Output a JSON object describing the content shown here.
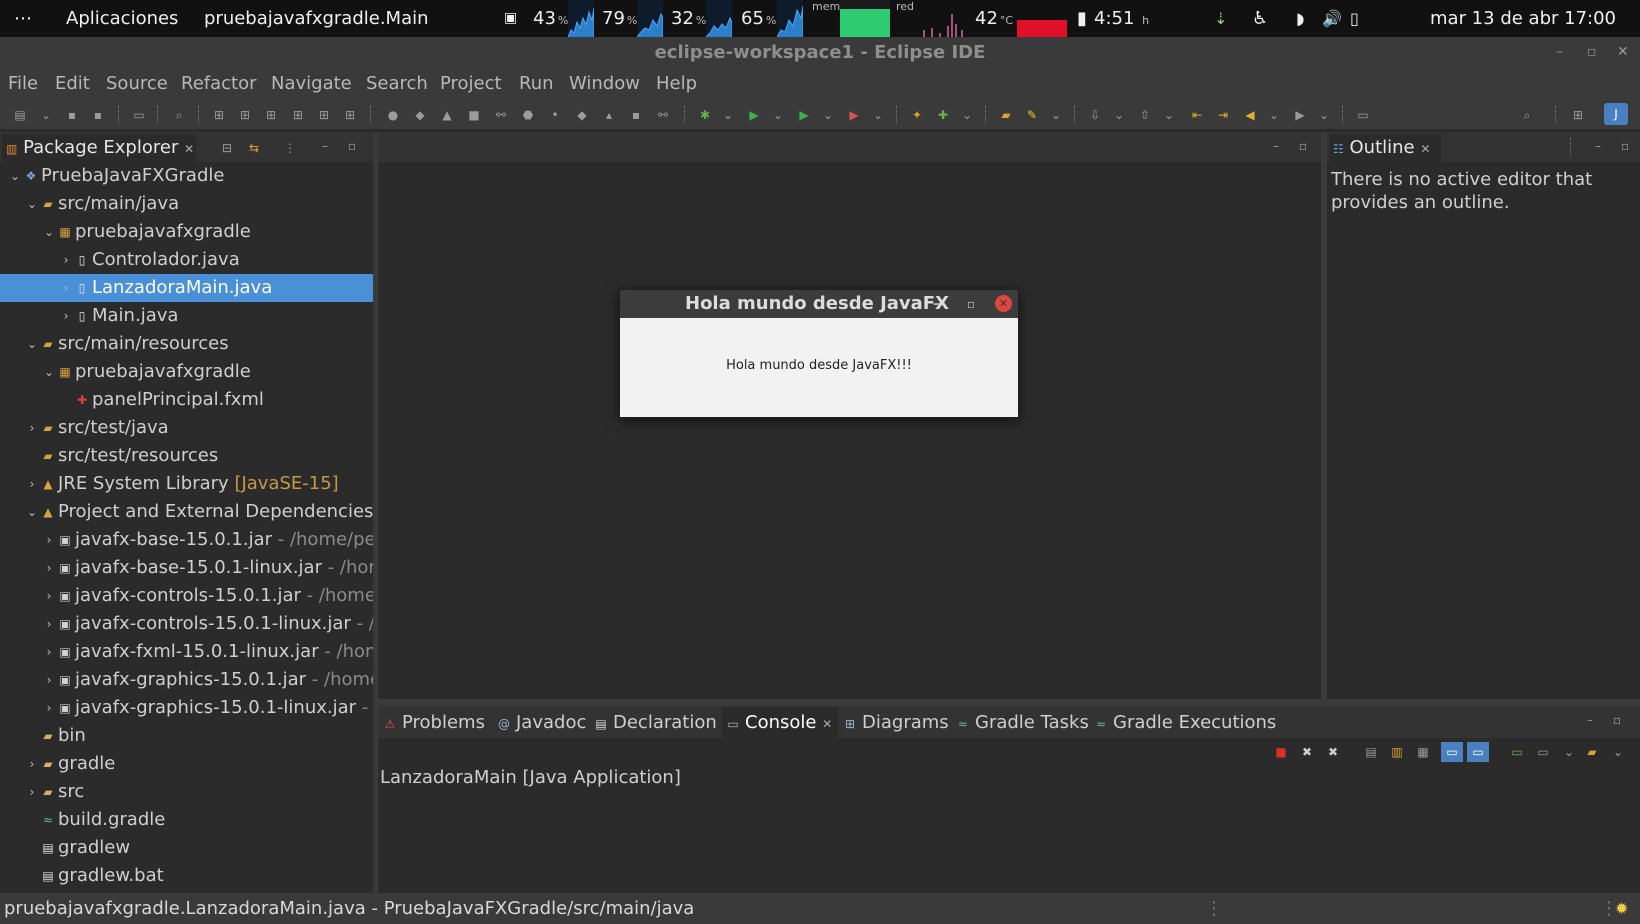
{
  "topbar": {
    "dots": "⋯",
    "apps": "Aplicaciones",
    "app_title": "pruebajavafxgradle.Main",
    "cpu": "43",
    "cpu_unit": "%",
    "mem_pct": "79",
    "mem_unit": "%",
    "swap_pct": "32",
    "swap_unit": "%",
    "load_pct": "65",
    "load_unit": "%",
    "mem_label": "mem",
    "net_label": "red",
    "temp": "42",
    "temp_unit": "°C",
    "battery_time": "4:51",
    "battery_unit": "h",
    "datetime": "mar 13 de abr  17:00"
  },
  "window": {
    "title": "eclipse-workspace1 - Eclipse IDE",
    "minimize": "–",
    "restore": "▫",
    "close": "✕"
  },
  "menu": [
    "File",
    "Edit",
    "Source",
    "Refactor",
    "Navigate",
    "Search",
    "Project",
    "Run",
    "Window",
    "Help"
  ],
  "package_explorer": {
    "title": "Package Explorer",
    "tree": [
      {
        "level": 0,
        "twisty": "v",
        "icon": "project-icon",
        "label": "PruebaJavaFXGradle",
        "dec": ""
      },
      {
        "level": 1,
        "twisty": "v",
        "icon": "source-folder-icon",
        "label": "src/main/java",
        "dec": ""
      },
      {
        "level": 2,
        "twisty": "v",
        "icon": "package-icon",
        "label": "pruebajavafxgradle",
        "dec": ""
      },
      {
        "level": 3,
        "twisty": ">",
        "icon": "java-file-icon",
        "label": "Controlador.java",
        "dec": ""
      },
      {
        "level": 3,
        "twisty": ">",
        "icon": "java-file-icon",
        "label": "LanzadoraMain.java",
        "dec": "",
        "selected": true
      },
      {
        "level": 3,
        "twisty": ">",
        "icon": "java-file-icon",
        "label": "Main.java",
        "dec": ""
      },
      {
        "level": 1,
        "twisty": "v",
        "icon": "source-folder-icon",
        "label": "src/main/resources",
        "dec": ""
      },
      {
        "level": 2,
        "twisty": "v",
        "icon": "package-icon",
        "label": "pruebajavafxgradle",
        "dec": ""
      },
      {
        "level": 3,
        "twisty": "",
        "icon": "fxml-file-icon",
        "label": "panelPrincipal.fxml",
        "dec": ""
      },
      {
        "level": 1,
        "twisty": ">",
        "icon": "source-folder-icon",
        "label": "src/test/java",
        "dec": ""
      },
      {
        "level": 1,
        "twisty": "",
        "icon": "source-folder-icon",
        "label": "src/test/resources",
        "dec": ""
      },
      {
        "level": 1,
        "twisty": ">",
        "icon": "library-icon",
        "label": "JRE System Library",
        "dec": "[JavaSE-15]",
        "jre": true
      },
      {
        "level": 1,
        "twisty": "v",
        "icon": "library-icon",
        "label": "Project and External Dependencies",
        "dec": ""
      },
      {
        "level": 2,
        "twisty": ">",
        "icon": "jar-icon",
        "label": "javafx-base-15.0.1.jar",
        "dec": " - /home/pep"
      },
      {
        "level": 2,
        "twisty": ">",
        "icon": "jar-icon",
        "label": "javafx-base-15.0.1-linux.jar",
        "dec": " - /hom"
      },
      {
        "level": 2,
        "twisty": ">",
        "icon": "jar-icon",
        "label": "javafx-controls-15.0.1.jar",
        "dec": " - /home/"
      },
      {
        "level": 2,
        "twisty": ">",
        "icon": "jar-icon",
        "label": "javafx-controls-15.0.1-linux.jar",
        "dec": " - /h"
      },
      {
        "level": 2,
        "twisty": ">",
        "icon": "jar-icon",
        "label": "javafx-fxml-15.0.1-linux.jar",
        "dec": " - /home"
      },
      {
        "level": 2,
        "twisty": ">",
        "icon": "jar-icon",
        "label": "javafx-graphics-15.0.1.jar",
        "dec": " - /home/"
      },
      {
        "level": 2,
        "twisty": ">",
        "icon": "jar-icon",
        "label": "javafx-graphics-15.0.1-linux.jar",
        "dec": " - /h"
      },
      {
        "level": 1,
        "twisty": "",
        "icon": "folder-icon",
        "label": "bin",
        "dec": ""
      },
      {
        "level": 1,
        "twisty": ">",
        "icon": "folder-icon",
        "label": "gradle",
        "dec": ""
      },
      {
        "level": 1,
        "twisty": ">",
        "icon": "folder-icon",
        "label": "src",
        "dec": ""
      },
      {
        "level": 1,
        "twisty": "",
        "icon": "gradle-file-icon",
        "label": "build.gradle",
        "dec": ""
      },
      {
        "level": 1,
        "twisty": "",
        "icon": "file-icon",
        "label": "gradlew",
        "dec": ""
      },
      {
        "level": 1,
        "twisty": "",
        "icon": "file-icon",
        "label": "gradlew.bat",
        "dec": ""
      }
    ]
  },
  "outline": {
    "title": "Outline",
    "message": "There is no active editor that provides an outline."
  },
  "dialog": {
    "title": "Hola mundo desde JavaFX",
    "message": "Hola mundo desde JavaFX!!!"
  },
  "bottom_tabs": [
    {
      "label": "Problems",
      "icon": "problems-icon"
    },
    {
      "label": "Javadoc",
      "icon": "javadoc-icon"
    },
    {
      "label": "Declaration",
      "icon": "declaration-icon"
    },
    {
      "label": "Console",
      "icon": "console-icon",
      "active": true
    },
    {
      "label": "Diagrams",
      "icon": "diagrams-icon"
    },
    {
      "label": "Gradle Tasks",
      "icon": "gradle-tasks-icon"
    },
    {
      "label": "Gradle Executions",
      "icon": "gradle-executions-icon"
    }
  ],
  "console": {
    "text": "LanzadoraMain [Java Application]"
  },
  "status": {
    "text": "pruebajavafxgradle.LanzadoraMain.java - PruebaJavaFXGradle/src/main/java"
  },
  "colors": {
    "selection": "#4a90d9",
    "close_red": "#e0443e",
    "mem_green": "#2ecc71",
    "net_red": "#e0102a"
  }
}
